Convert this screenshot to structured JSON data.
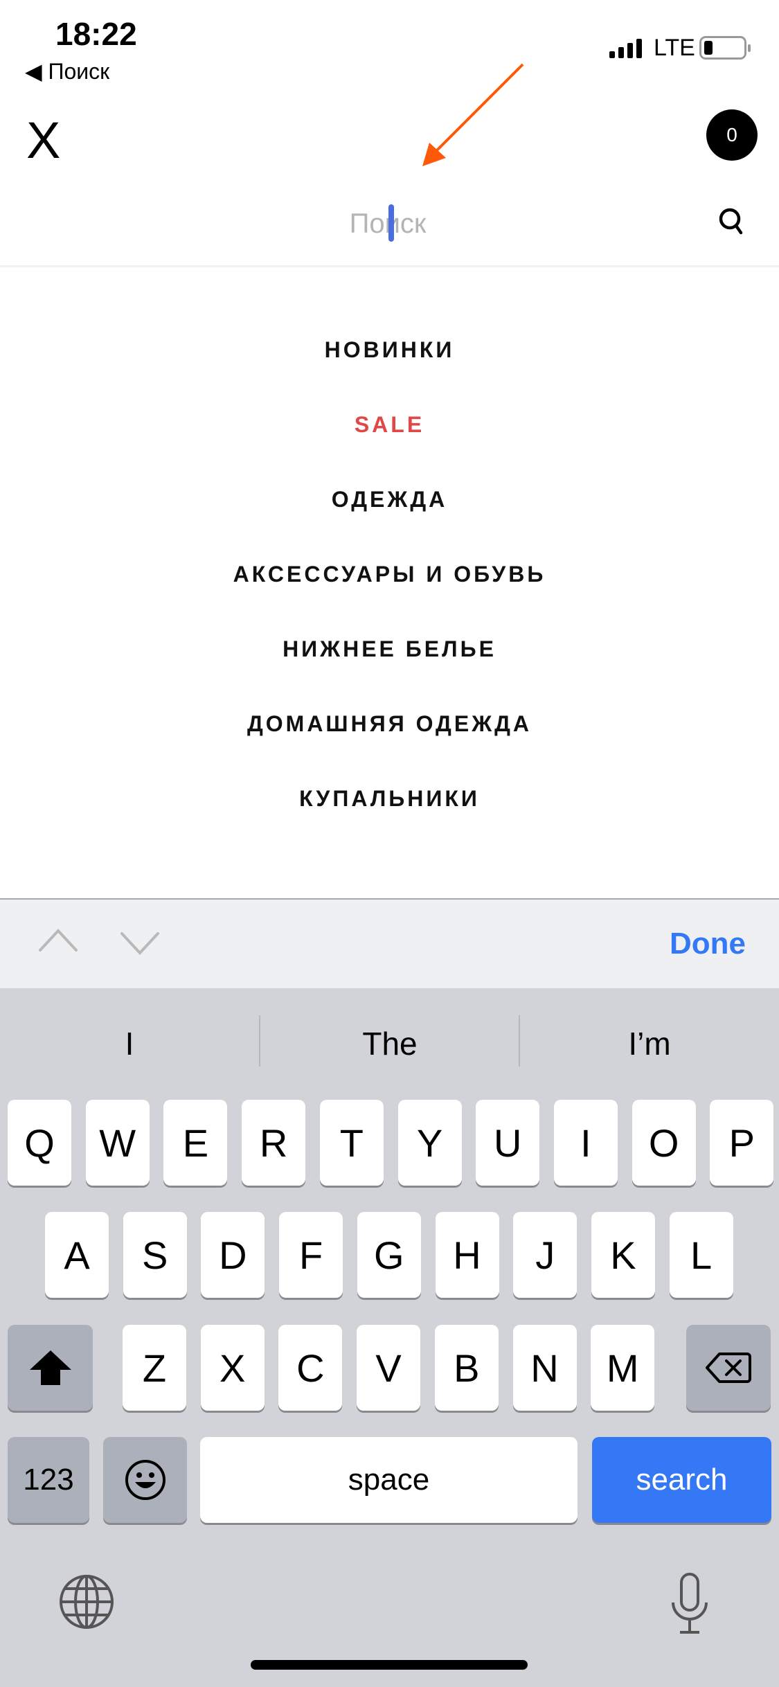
{
  "status_bar": {
    "time": "18:22",
    "back_label": "◀ Поиск",
    "network": "LTE",
    "battery_level": 0.15
  },
  "header": {
    "logo": "X",
    "cart_count": "0"
  },
  "search": {
    "placeholder": "Поиск",
    "value": ""
  },
  "menu": [
    {
      "label": "НОВИНКИ",
      "color": "#111111"
    },
    {
      "label": "SALE",
      "color": "#e04848"
    },
    {
      "label": "ОДЕЖДА",
      "color": "#111111"
    },
    {
      "label": "АКСЕССУАРЫ И ОБУВЬ",
      "color": "#111111"
    },
    {
      "label": "НИЖНЕЕ БЕЛЬЕ",
      "color": "#111111"
    },
    {
      "label": "ДОМАШНЯЯ ОДЕЖДА",
      "color": "#111111"
    },
    {
      "label": "КУПАЛЬНИКИ",
      "color": "#111111"
    }
  ],
  "keyboard_toolbar": {
    "done_label": "Done"
  },
  "suggestions": [
    "I",
    "The",
    "I’m"
  ],
  "keyboard": {
    "row1": [
      "Q",
      "W",
      "E",
      "R",
      "T",
      "Y",
      "U",
      "I",
      "O",
      "P"
    ],
    "row2": [
      "A",
      "S",
      "D",
      "F",
      "G",
      "H",
      "J",
      "K",
      "L"
    ],
    "row3": [
      "Z",
      "X",
      "C",
      "V",
      "B",
      "N",
      "M"
    ],
    "numbers_label": "123",
    "space_label": "space",
    "search_label": "search"
  },
  "colors": {
    "accent": "#3478f6",
    "sale": "#e04848",
    "annotation_arrow": "#ff5a0a"
  }
}
